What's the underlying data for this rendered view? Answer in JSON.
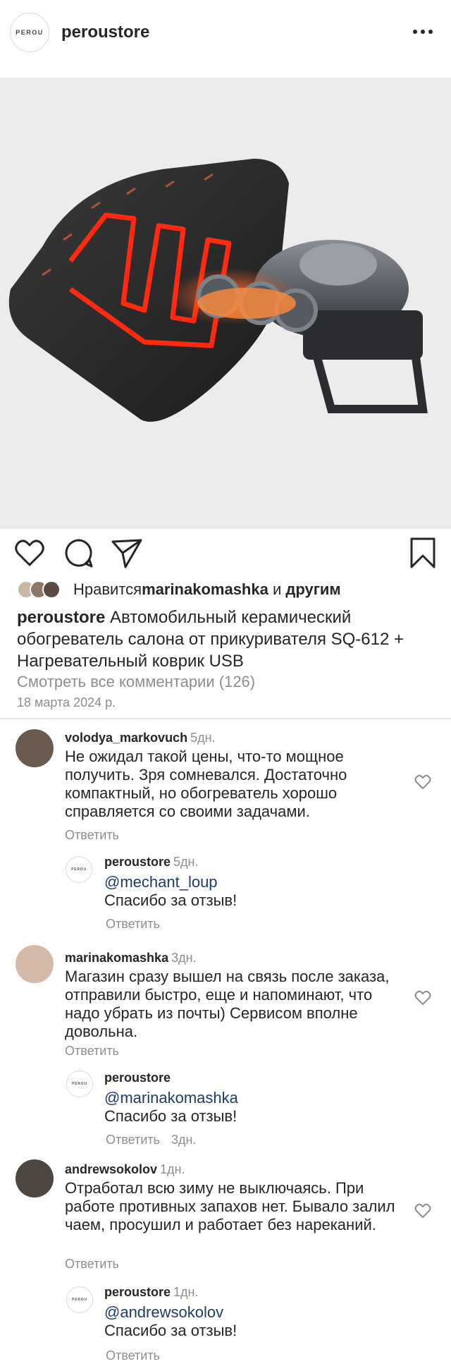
{
  "header": {
    "logo_text": "PEROU",
    "username": "peroustore"
  },
  "post": {
    "liked_by_prefix": "Нравится ",
    "liked_by_user": "marinakomashka",
    "liked_by_suffix": " и ",
    "liked_by_others": "другим",
    "caption_user": "peroustore",
    "caption_text": " Автомобильный керамический обогреватель салона от прикуривателя SQ-612 + Нагревательный коврик USB",
    "view_all": "Смотреть все комментарии (126)",
    "date": "18 марта 2024 р."
  },
  "comments": [
    {
      "user": "volodya_markovuch",
      "time": "5дн.",
      "text": "Не ожидал такой цены, что-то мощное получить. Зря сомневался. Достаточно компактный, но обогреватель хорошо справляется со своими задачами.",
      "reply_label": "Ответить",
      "reply": {
        "logo_text": "PEROU",
        "user": "peroustore",
        "time": "5дн.",
        "mention": "@mechant_loup",
        "text": "Спасибо за отзыв!",
        "reply_label": "Ответить"
      }
    },
    {
      "user": "marinakomashka",
      "time": "3дн.",
      "text": "Магазин сразу вышел на связь после заказа, отправили быстро, еще и напоминают, что надо убрать из почты) Сервисом вполне довольна.",
      "reply_label": "Ответить",
      "reply": {
        "logo_text": "PEROU",
        "user": "peroustore",
        "time": "3дн.",
        "mention": "@marinakomashka",
        "text": "Спасибо за отзыв!",
        "reply_label": "Ответить"
      }
    },
    {
      "user": "andrewsokolov",
      "time": "1дн.",
      "text": "Отработал всю зиму не выключаясь. При работе противных запахов нет. Бывало залил чаем, просушил и работает без нареканий.",
      "reply_label": "Ответить",
      "reply": {
        "logo_text": "PEROU",
        "user": "peroustore",
        "time": "1дн.",
        "mention": "@andrewsokolov",
        "text": "Спасибо за отзыв!",
        "reply_label": "Ответить"
      }
    }
  ],
  "icons": {
    "like": "heart-icon",
    "comment": "comment-icon",
    "share": "paper-plane-icon",
    "save": "bookmark-icon",
    "more": "more-dots-icon"
  },
  "colors": {
    "text": "#262626",
    "muted": "#8e8e8e",
    "mention": "#1f3b6b",
    "heater_glow": "#ff2a10"
  }
}
